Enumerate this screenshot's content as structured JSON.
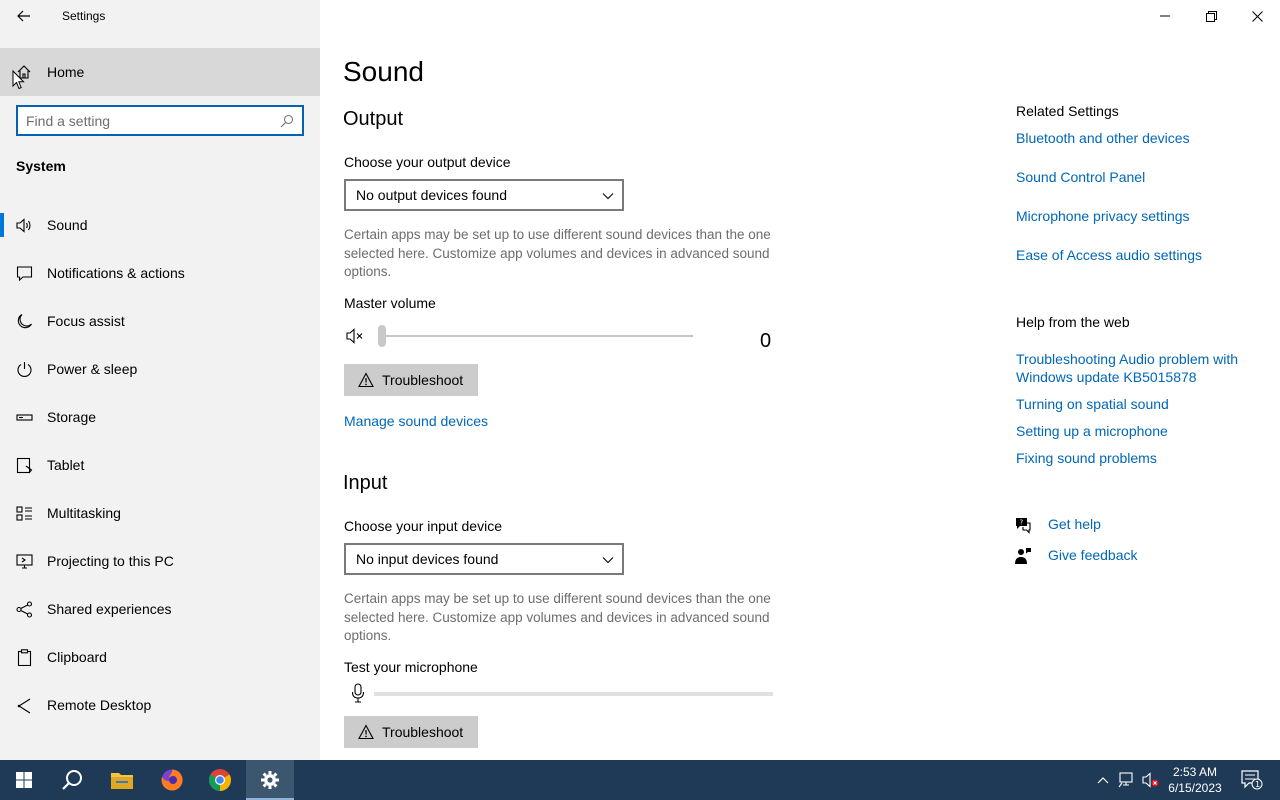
{
  "window": {
    "title": "Settings"
  },
  "sidebar": {
    "home_label": "Home",
    "search_placeholder": "Find a setting",
    "section_header": "System",
    "items": [
      {
        "label": "Sound",
        "icon": "speaker-icon",
        "active": true
      },
      {
        "label": "Notifications & actions",
        "icon": "notification-icon"
      },
      {
        "label": "Focus assist",
        "icon": "moon-icon"
      },
      {
        "label": "Power & sleep",
        "icon": "power-icon"
      },
      {
        "label": "Storage",
        "icon": "storage-icon"
      },
      {
        "label": "Tablet",
        "icon": "tablet-icon"
      },
      {
        "label": "Multitasking",
        "icon": "multitasking-icon"
      },
      {
        "label": "Projecting to this PC",
        "icon": "projecting-icon"
      },
      {
        "label": "Shared experiences",
        "icon": "shared-experiences-icon"
      },
      {
        "label": "Clipboard",
        "icon": "clipboard-icon"
      },
      {
        "label": "Remote Desktop",
        "icon": "remote-desktop-icon"
      }
    ]
  },
  "main": {
    "title": "Sound",
    "output": {
      "heading": "Output",
      "device_label": "Choose your output device",
      "device_value": "No output devices found",
      "description": "Certain apps may be set up to use different sound devices than the one selected here. Customize app volumes and devices in advanced sound options.",
      "volume_label": "Master volume",
      "volume_value": "0",
      "volume_level": 0,
      "troubleshoot_label": "Troubleshoot",
      "manage_link": "Manage sound devices"
    },
    "input": {
      "heading": "Input",
      "device_label": "Choose your input device",
      "device_value": "No input devices found",
      "description": "Certain apps may be set up to use different sound devices than the one selected here. Customize app volumes and devices in advanced sound options.",
      "test_label": "Test your microphone",
      "mic_level": 0,
      "troubleshoot_label": "Troubleshoot"
    }
  },
  "related": {
    "title": "Related Settings",
    "links": [
      "Bluetooth and other devices",
      "Sound Control Panel",
      "Microphone privacy settings",
      "Ease of Access audio settings"
    ]
  },
  "help": {
    "title": "Help from the web",
    "links": [
      "Troubleshooting Audio problem with Windows update KB5015878",
      "Turning on spatial sound",
      "Setting up a microphone",
      "Fixing sound problems"
    ],
    "get_help": "Get help",
    "give_feedback": "Give feedback"
  },
  "taskbar": {
    "time": "2:53 AM",
    "date": "6/15/2023",
    "notification_count": "1"
  },
  "colors": {
    "accent": "#0078d7",
    "link": "#0067b8",
    "taskbar": "#1f3a57",
    "sidebar": "#f2f2f2"
  }
}
